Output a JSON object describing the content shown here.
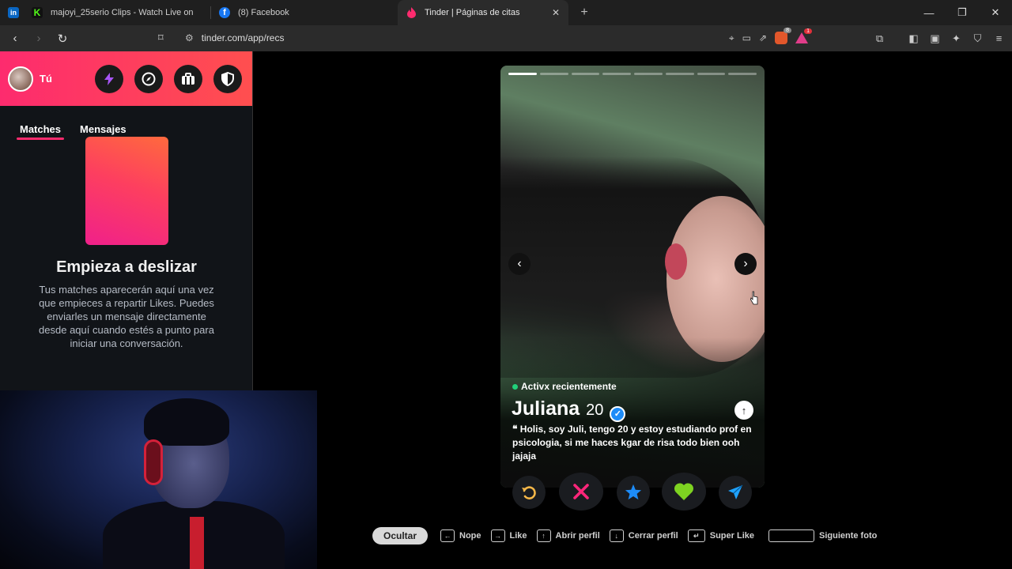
{
  "browser": {
    "tabs": [
      {
        "title": "",
        "favicon": "in",
        "favicon_color": "#0a66c2"
      },
      {
        "title": "majoyi_25serio Clips - Watch Live on",
        "favicon": "K",
        "favicon_color": "#53fc18"
      },
      {
        "title": "(8) Facebook",
        "favicon": "f",
        "favicon_color": "#1877f2"
      },
      {
        "title": "Tinder | Páginas de citas",
        "favicon": "tinder-flame-icon",
        "favicon_color": "#fd2b6e",
        "active": true
      }
    ],
    "url": "tinder.com/app/recs",
    "extension_badges": {
      "brave": "8",
      "rewards": "1"
    }
  },
  "sidebar": {
    "user_label": "Tú",
    "tabs": [
      {
        "label": "Matches",
        "active": true
      },
      {
        "label": "Mensajes",
        "active": false
      }
    ],
    "empty_title": "Empieza a deslizar",
    "empty_text": "Tus matches aparecerán aquí una vez que empieces a repartir Likes. Puedes enviarles un mensaje directamente desde aquí cuando estés a punto para iniciar una conversación."
  },
  "profile": {
    "status": "Activx recientemente",
    "name": "Juliana",
    "age": "20",
    "bio": "Holis, soy Juli, tengo 20 y estoy estudiando prof en psicologia, si me haces kgar de risa todo bien ooh jajaja",
    "photo_count": 8,
    "current_photo": 1
  },
  "shortcuts": {
    "hide": "Ocultar",
    "items": [
      {
        "key": "←",
        "label": "Nope"
      },
      {
        "key": "→",
        "label": "Like"
      },
      {
        "key": "↑",
        "label": "Abrir perfil"
      },
      {
        "key": "↓",
        "label": "Cerrar perfil"
      },
      {
        "key": "↵",
        "label": "Super Like"
      },
      {
        "key": "",
        "label": "Siguiente foto"
      }
    ]
  },
  "colors": {
    "brand": "#fd2b6e",
    "rewind": "#f5b748",
    "nope": "#fd267a",
    "superlike": "#1d8cf8",
    "like": "#7ed321",
    "boost": "#1fa3ff"
  }
}
